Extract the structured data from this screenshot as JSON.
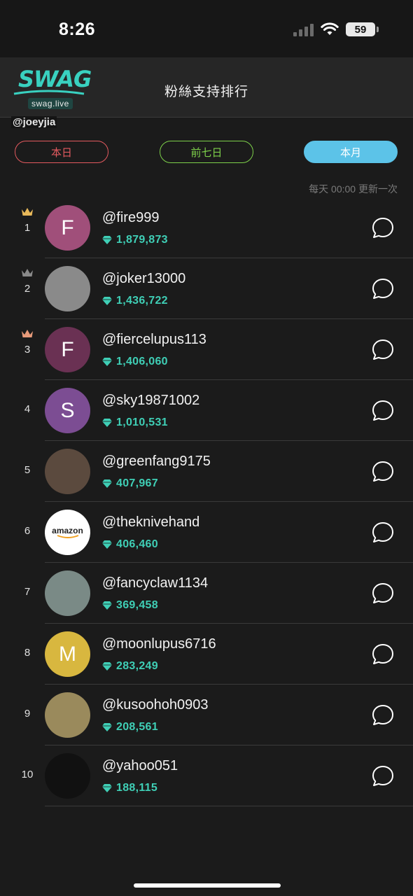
{
  "status_bar": {
    "time": "8:26",
    "battery": "59"
  },
  "header": {
    "title": "粉絲支持排行"
  },
  "logo": {
    "text": "SWAG",
    "sub": "swag.live"
  },
  "username_tag": "@joeyjia",
  "tabs": [
    {
      "label": "本日",
      "color": "#e35a5f",
      "active": false
    },
    {
      "label": "前七日",
      "color": "#7dd04a",
      "active": false
    },
    {
      "label": "本月",
      "color": "#5cc3e8",
      "active": true
    }
  ],
  "update_note": "每天 00:00 更新一次",
  "crown_colors": {
    "gold": "#e8b95a",
    "silver": "#8a8a8a",
    "bronze": "#e79a7a"
  },
  "accent_score": "#3fcfb6",
  "ranking": [
    {
      "rank": "1",
      "name": "@fire999",
      "score": "1,879,873",
      "avatar_letter": "F",
      "avatar_color": "#a04f7a",
      "crown": "gold"
    },
    {
      "rank": "2",
      "name": "@joker13000",
      "score": "1,436,722",
      "avatar_letter": "",
      "avatar_color": "#8a8a8a",
      "crown": "silver"
    },
    {
      "rank": "3",
      "name": "@fiercelupus113",
      "score": "1,406,060",
      "avatar_letter": "F",
      "avatar_color": "#6a3153",
      "crown": "bronze"
    },
    {
      "rank": "4",
      "name": "@sky19871002",
      "score": "1,010,531",
      "avatar_letter": "S",
      "avatar_color": "#7c4d93",
      "crown": ""
    },
    {
      "rank": "5",
      "name": "@greenfang9175",
      "score": "407,967",
      "avatar_letter": "",
      "avatar_color": "#5b4a3e",
      "crown": ""
    },
    {
      "rank": "6",
      "name": "@theknivehand",
      "score": "406,460",
      "avatar_letter": "amazon",
      "avatar_color": "#ffffff",
      "crown": ""
    },
    {
      "rank": "7",
      "name": "@fancyclaw1134",
      "score": "369,458",
      "avatar_letter": "",
      "avatar_color": "#7a8a86",
      "crown": ""
    },
    {
      "rank": "8",
      "name": "@moonlupus6716",
      "score": "283,249",
      "avatar_letter": "M",
      "avatar_color": "#d8b73f",
      "crown": ""
    },
    {
      "rank": "9",
      "name": "@kusoohoh0903",
      "score": "208,561",
      "avatar_letter": "",
      "avatar_color": "#9a8a5c",
      "crown": ""
    },
    {
      "rank": "10",
      "name": "@yahoo051",
      "score": "188,115",
      "avatar_letter": "",
      "avatar_color": "#111111",
      "crown": ""
    }
  ]
}
